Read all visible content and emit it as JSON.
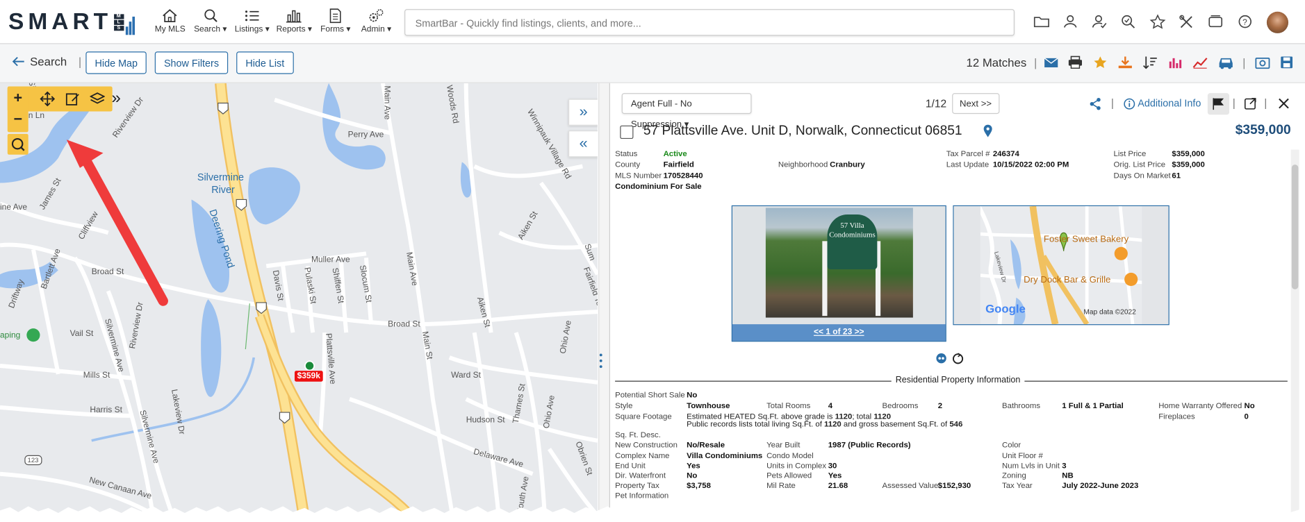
{
  "app": {
    "logo_text": "SMART",
    "logo_sub": "MLS",
    "nav": [
      {
        "label": "My MLS",
        "icon": "home-icon"
      },
      {
        "label": "Search ▾",
        "icon": "search-icon"
      },
      {
        "label": "Listings ▾",
        "icon": "list-icon"
      },
      {
        "label": "Reports ▾",
        "icon": "bar-chart-icon"
      },
      {
        "label": "Forms ▾",
        "icon": "document-icon"
      },
      {
        "label": "Admin ▾",
        "icon": "gears-icon"
      }
    ],
    "smartbar_placeholder": "SmartBar - Quickly find listings, clients, and more...",
    "right_icons": [
      "folder-icon",
      "contacts-icon",
      "user-check-icon",
      "saved-search-icon",
      "star-icon",
      "tools-icon",
      "cards-icon",
      "support-icon",
      "avatar"
    ]
  },
  "toolbar": {
    "back_label": "Search",
    "sep": "|",
    "hide_map": "Hide Map",
    "show_filters": "Show Filters",
    "hide_list": "Hide List",
    "matches": "12 Matches",
    "icons": [
      "email-icon",
      "print-icon",
      "star-icon",
      "download-icon",
      "sort-icon",
      "chart-icon",
      "trend-icon",
      "car-icon",
      "camera-folder-icon",
      "save-icon"
    ]
  },
  "map": {
    "labels": [
      {
        "text": "Silvermine",
        "color": "#2b6fa8"
      },
      {
        "text": "River",
        "color": "#2b6fa8"
      },
      {
        "text": "Deering Pond",
        "color": "#2b6fa8"
      },
      {
        "text": "Perry Ave"
      },
      {
        "text": "Main Ave"
      },
      {
        "text": "Woods Rd"
      },
      {
        "text": "Winnipauk Village Rd"
      },
      {
        "text": "Riverview Dr"
      },
      {
        "text": "James St"
      },
      {
        "text": "Cliffview"
      },
      {
        "text": "Bartlett Ave"
      },
      {
        "text": "Driftway"
      },
      {
        "text": "Broad St"
      },
      {
        "text": "Muller Ave"
      },
      {
        "text": "Davis St"
      },
      {
        "text": "Pulaski St"
      },
      {
        "text": "Shiffen St"
      },
      {
        "text": "Slocum St"
      },
      {
        "text": "Main St"
      },
      {
        "text": "Aiken St"
      },
      {
        "text": "Fairfield Terrace"
      },
      {
        "text": "Vail St"
      },
      {
        "text": "Mills St"
      },
      {
        "text": "Harris St"
      },
      {
        "text": "Silvermine Ave"
      },
      {
        "text": "Riverview Dr"
      },
      {
        "text": "Plattsville Ave"
      },
      {
        "text": "Ward St"
      },
      {
        "text": "Thames St"
      },
      {
        "text": "Hudson St"
      },
      {
        "text": "Ohio Ave"
      },
      {
        "text": "Delaware Ave"
      },
      {
        "text": "Lakeview Dr"
      },
      {
        "text": "New Canaan Ave"
      },
      {
        "text": "Obrien St"
      },
      {
        "text": "South Ave"
      },
      {
        "text": "aping"
      },
      {
        "text": "Sum"
      },
      {
        "text": "ine Ave"
      },
      {
        "text": "Silve"
      },
      {
        "text": "n Ln"
      },
      {
        "text": "7"
      },
      {
        "text": "123"
      }
    ],
    "price_pin": "$359k",
    "controls": [
      "zoom-in-button",
      "zoom-out-button",
      "locate-button",
      "pan-icon",
      "edit-icon",
      "layers-icon",
      "expand-icon"
    ],
    "zoom_in": "+",
    "zoom_out": "−",
    "expand_right": "»",
    "collapse_left": "«"
  },
  "detail": {
    "dropdown": "Agent Full - No Suppression ▾",
    "pager": "1/12",
    "next": "Next >>",
    "additional_info": "Additional Info",
    "address": "57 Plattsville Ave. Unit D, Norwalk, Connecticut 06851",
    "price": "$359,000",
    "summary": {
      "status_l": "Status",
      "status_v": "Active",
      "county_l": "County",
      "county_v": "Fairfield",
      "mls_l": "MLS Number",
      "mls_v": "170528440",
      "type": "Condominium For Sale",
      "neighborhood_l": "Neighborhood",
      "neighborhood_v": "Cranbury",
      "tax_parcel_l": "Tax Parcel #",
      "tax_parcel_v": "246374",
      "last_update_l": "Last Update",
      "last_update_v": "10/15/2022 02:00 PM",
      "list_price_l": "List Price",
      "list_price_v": "$359,000",
      "orig_price_l": "Orig. List Price",
      "orig_price_v": "$359,000",
      "dom_l": "Days On Market",
      "dom_v": "61"
    },
    "photo_caption": "<< 1 of 23 >>",
    "sign_text": "57 Villa Condominiums",
    "minimap": {
      "poi1": "Foster Sweet Bakery",
      "poi2": "Dry Dock Bar & Grille",
      "google": "Google",
      "mapdata": "Map data ©2022",
      "road": "Lakeview Dr"
    },
    "section_title": "Residential Property Information",
    "rows": {
      "pss_l": "Potential Short Sale",
      "pss_v": "No",
      "style_l": "Style",
      "style_v": "Townhouse",
      "rooms_l": "Total Rooms",
      "rooms_v": "4",
      "beds_l": "Bedrooms",
      "beds_v": "2",
      "baths_l": "Bathrooms",
      "baths_v": "1 Full & 1 Partial",
      "hw_l": "Home Warranty Offered",
      "hw_v": "No",
      "sqft_l": "Square Footage",
      "sqft_line1a": "Estimated HEATED Sq.Ft. above grade is ",
      "sqft_line1b": "1120",
      "sqft_line1c": "; total ",
      "sqft_line1d": "1120",
      "sqft_line2a": "Public records lists total living Sq.Ft. of ",
      "sqft_line2b": "1120",
      "sqft_line2c": " and gross basement Sq.Ft. of ",
      "sqft_line2d": "546",
      "fp_l": "Fireplaces",
      "fp_v": "0",
      "sqdesc_l": "Sq. Ft. Desc.",
      "newc_l": "New Construction",
      "newc_v": "No/Resale",
      "yb_l": "Year Built",
      "yb_v": "1987 (Public Records)",
      "color_l": "Color",
      "cname_l": "Complex Name",
      "cname_v": "Villa Condominiums",
      "cmodel_l": "Condo Model",
      "unitfl_l": "Unit Floor #",
      "endu_l": "End Unit",
      "endu_v": "Yes",
      "units_l": "Units in Complex",
      "units_v": "30",
      "lvls_l": "Num Lvls in Unit",
      "lvls_v": "3",
      "dirw_l": "Dir. Waterfront",
      "dirw_v": "No",
      "pets_l": "Pets Allowed",
      "pets_v": "Yes",
      "zoning_l": "Zoning",
      "zoning_v": "NB",
      "ptax_l": "Property Tax",
      "ptax_v": "$3,758",
      "mil_l": "Mil Rate",
      "mil_v": "21.68",
      "assess_l": "Assessed Value",
      "assess_v": "$152,930",
      "taxyr_l": "Tax Year",
      "taxyr_v": "July 2022-June 2023",
      "pet_l": "Pet Information"
    }
  },
  "colors": {
    "accent": "#2b6fa8",
    "active": "#1a8a1a",
    "pin": "#e11111",
    "control": "#f6c344",
    "arrow": "#ef3b3b"
  }
}
